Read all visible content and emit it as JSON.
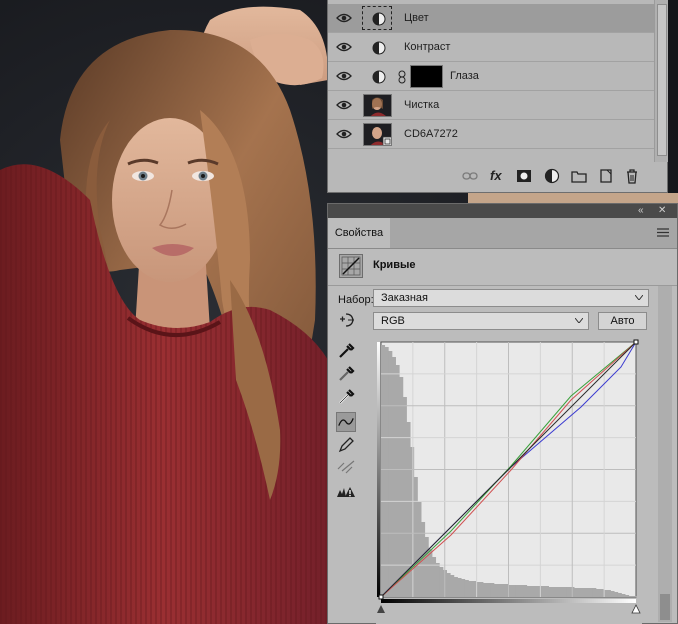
{
  "layers": {
    "items": [
      {
        "name": "Цвет",
        "kind": "adjustment",
        "selected": true
      },
      {
        "name": "Контраст",
        "kind": "adjustment",
        "selected": false
      },
      {
        "name": "Глаза",
        "kind": "adjustment-with-mask",
        "selected": false
      },
      {
        "name": "Чистка",
        "kind": "pixel",
        "selected": false
      },
      {
        "name": "CD6A7272",
        "kind": "smart-object",
        "selected": false
      }
    ],
    "toolbar_icons": [
      "link-layers-icon",
      "fx-icon",
      "add-mask-icon",
      "adjustment-layer-icon",
      "folder-icon",
      "new-layer-icon",
      "trash-icon"
    ],
    "fx_label": "fx"
  },
  "properties": {
    "tab_label": "Свойства",
    "panel_title": "Кривые",
    "preset_label": "Набор:",
    "preset_value": "Заказная",
    "channel_value": "RGB",
    "auto_label": "Авто",
    "tools": [
      "target-adjust-icon",
      "black-point-eyedropper-icon",
      "gray-point-eyedropper-icon",
      "white-point-eyedropper-icon",
      "curve-point-tool-icon",
      "pencil-icon",
      "smooth-icon",
      "clipping-warning-icon"
    ]
  },
  "colors": {
    "panel_bg": "#bcbcbc",
    "selected_row": "#9c9c9c",
    "curve_rgb": "#2a2a2a",
    "curve_red": "#d05050",
    "curve_green": "#3aa03a",
    "curve_blue": "#3a3ad0",
    "sweater": "#8e2a2c"
  },
  "chart_data": {
    "type": "line",
    "xlim": [
      0,
      255
    ],
    "ylim": [
      0,
      255
    ],
    "series": [
      {
        "name": "RGB",
        "x": [
          0,
          255
        ],
        "y": [
          0,
          255
        ]
      },
      {
        "name": "Red",
        "x": [
          0,
          70,
          130,
          190,
          255
        ],
        "y": [
          0,
          62,
          127,
          197,
          255
        ]
      },
      {
        "name": "Green",
        "x": [
          0,
          70,
          130,
          190,
          255
        ],
        "y": [
          0,
          66,
          131,
          201,
          255
        ]
      },
      {
        "name": "Blue",
        "x": [
          0,
          60,
          130,
          200,
          240,
          255
        ],
        "y": [
          0,
          60,
          130,
          190,
          230,
          255
        ]
      }
    ],
    "histogram": [
      252,
      250,
      246,
      240,
      232,
      220,
      200,
      175,
      150,
      120,
      95,
      75,
      60,
      48,
      40,
      34,
      30,
      27,
      24,
      22,
      20,
      19,
      18,
      17,
      16,
      16,
      15,
      15,
      14,
      14,
      14,
      13,
      13,
      13,
      13,
      12,
      12,
      12,
      12,
      12,
      11,
      11,
      11,
      11,
      11,
      11,
      10,
      10,
      10,
      10,
      10,
      10,
      10,
      9,
      9,
      9,
      9,
      9,
      9,
      8,
      8,
      7,
      7,
      6,
      5,
      4,
      3,
      2,
      1,
      1
    ],
    "grid": "4x4 fine"
  }
}
